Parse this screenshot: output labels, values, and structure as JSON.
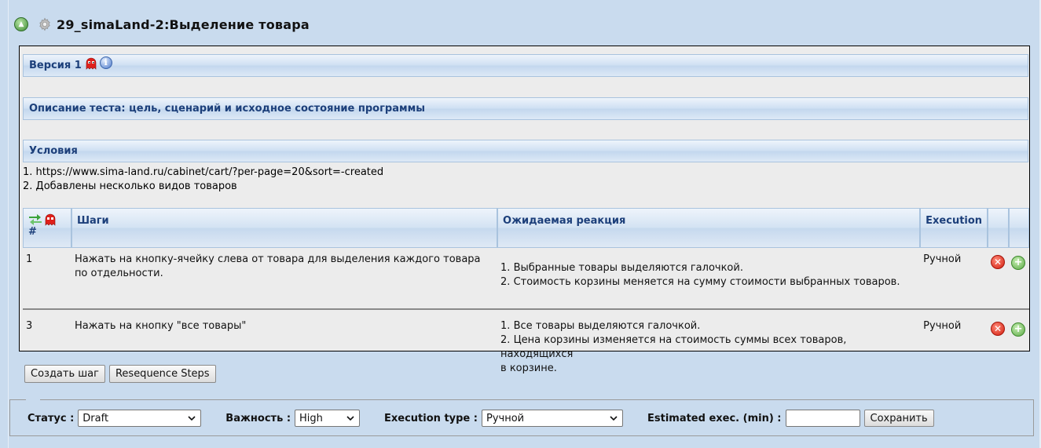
{
  "header": {
    "title": "29_simaLand-2:Выделение товара"
  },
  "version": {
    "label": "Версия 1"
  },
  "description": {
    "heading": "Описание теста: цель, сценарий и исходное состояние программы"
  },
  "conditions": {
    "heading": "Условия",
    "lines": [
      "1. https://www.sima-land.ru/cabinet/cart/?per-page=20&sort=-created",
      "2. Добавлены несколько видов товаров"
    ]
  },
  "steps": {
    "columns": {
      "num": "#",
      "action": "Шаги",
      "expected": "Ожидаемая реакция",
      "execution": "Execution"
    },
    "rows": [
      {
        "num": "1",
        "action": "Нажать на кнопку-ячейку слева от товара для выделения каждого товара по отдельности.",
        "expected_lines": [
          "1. Выбранные товары выделяются галочкой.",
          "2. Стоимость корзины меняется на сумму стоимости выбранных товаров."
        ],
        "execution": "Ручной"
      },
      {
        "num": "3",
        "action": "Нажать на кнопку \"все товары\"",
        "expected_lines": [
          "1. Все товары выделяются галочкой.",
          "2. Цена корзины изменяется на стоимость суммы всех товаров, находящихся",
          "в корзине."
        ],
        "execution": "Ручной"
      }
    ]
  },
  "buttons": {
    "create_step": "Создать шаг",
    "resequence": "Resequence Steps"
  },
  "footer": {
    "status_label": "Статус :",
    "status_value": "Draft",
    "importance_label": "Важность :",
    "importance_value": "High",
    "exec_type_label": "Execution type :",
    "exec_type_value": "Ручной",
    "estimated_label": "Estimated exec. (min) :",
    "estimated_value": "",
    "save_label": "Сохранить"
  },
  "icons": {
    "testcase": "testcase-icon",
    "settings": "gear-icon",
    "ghost": "ghost-icon",
    "info": "info-icon",
    "reorder": "reorder-arrows-icon",
    "delete": "delete-icon",
    "add": "add-icon",
    "dropdown": "chevron-down-icon"
  },
  "colors": {
    "page_bg": "#c9dbee",
    "heading_text": "#1c3f7a",
    "panel_bg": "#ececec"
  }
}
